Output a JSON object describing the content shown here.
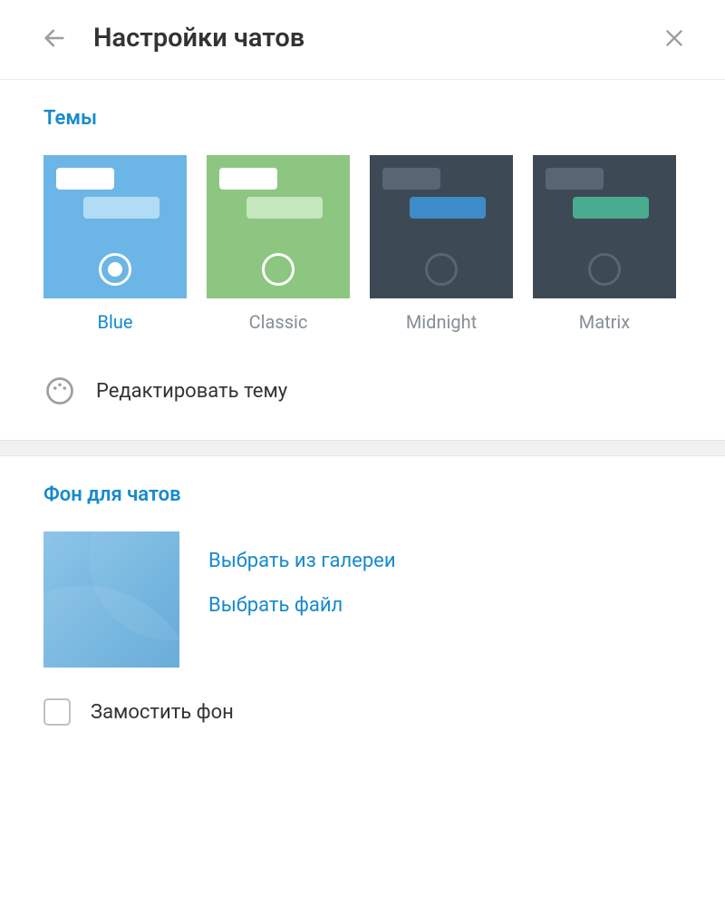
{
  "header": {
    "title": "Настройки чатов"
  },
  "themes": {
    "section_title": "Темы",
    "items": [
      {
        "label": "Blue",
        "bg": "#6bb6e6",
        "bubble1": "#ffffff",
        "bubble2": "#b2dcf4",
        "radio_border": "#ffffff",
        "radio_fill": "#ffffff",
        "selected": true
      },
      {
        "label": "Classic",
        "bg": "#8dc680",
        "bubble1": "#ffffff",
        "bubble2": "#c6e6be",
        "radio_border": "#ffffff",
        "radio_fill": "",
        "selected": false
      },
      {
        "label": "Midnight",
        "bg": "#3d4a55",
        "bubble1": "#586673",
        "bubble2": "#3d8bc9",
        "radio_border": "#586673",
        "radio_fill": "",
        "selected": false
      },
      {
        "label": "Matrix",
        "bg": "#3d4a55",
        "bubble1": "#586673",
        "bubble2": "#4aac8f",
        "radio_border": "#586673",
        "radio_fill": "",
        "selected": false
      }
    ],
    "edit_label": "Редактировать тему"
  },
  "background": {
    "section_title": "Фон для чатов",
    "choose_gallery": "Выбрать из галереи",
    "choose_file": "Выбрать файл",
    "tile_label": "Замостить фон",
    "tile_checked": false
  }
}
